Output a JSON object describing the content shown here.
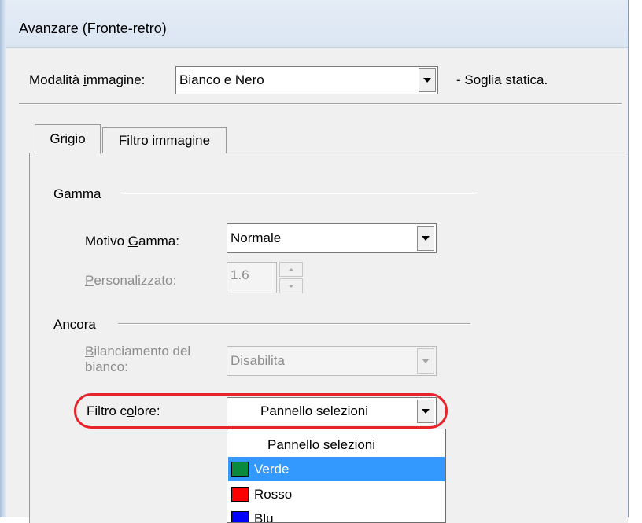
{
  "window": {
    "title": "Avanzare (Fronte-retro)"
  },
  "image_mode": {
    "label_before": "Modalità ",
    "label_accel": "i",
    "label_after": "mmagine:",
    "value": "Bianco e Nero",
    "note": "- Soglia statica."
  },
  "tabs": [
    {
      "label": "Grigio",
      "active": true
    },
    {
      "label": "Filtro immagine",
      "active": false
    }
  ],
  "gamma": {
    "group_label": "Gamma",
    "pattern_label_before": "Motivo ",
    "pattern_label_accel": "G",
    "pattern_label_after": "amma:",
    "pattern_value": "Normale",
    "custom_label_accel": "P",
    "custom_label_after": "ersonalizzato:",
    "custom_value": "1.6"
  },
  "ancora": {
    "group_label": "Ancora",
    "white_balance_label_accel": "B",
    "white_balance_label_line1_after": "ilanciamento del",
    "white_balance_label_line2": "bianco:",
    "white_balance_value": "Disabilita",
    "color_filter_label_before": "Filtro c",
    "color_filter_label_accel": "o",
    "color_filter_label_after": "lore:",
    "color_filter_value": "Pannello selezioni"
  },
  "dropdown": {
    "options": [
      {
        "label": "Pannello selezioni",
        "color": null,
        "selected": false
      },
      {
        "label": "Verde",
        "color": "#0a8a3c",
        "selected": true
      },
      {
        "label": "Rosso",
        "color": "#ff0000",
        "selected": false
      },
      {
        "label": "Blu",
        "color": "#0000ff",
        "selected": false
      }
    ]
  },
  "colors": {
    "highlight": "#e8232a",
    "selection": "#3399ff"
  }
}
